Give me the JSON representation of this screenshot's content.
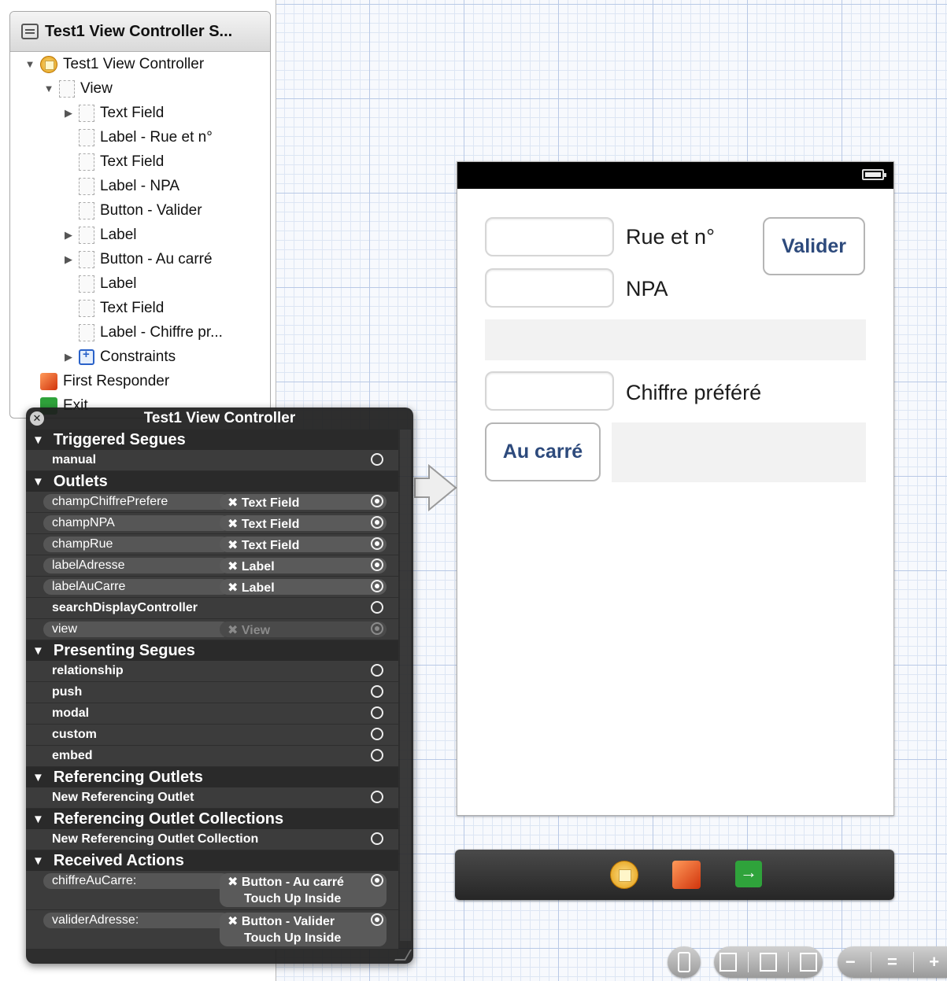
{
  "outline": {
    "header": "Test1 View Controller S...",
    "items": [
      {
        "label": "Test1 View Controller"
      },
      {
        "label": "View"
      },
      {
        "label": "Text Field"
      },
      {
        "label": "Label - Rue et n°"
      },
      {
        "label": "Text Field"
      },
      {
        "label": "Label - NPA"
      },
      {
        "label": "Button - Valider"
      },
      {
        "label": "Label"
      },
      {
        "label": "Button - Au carré"
      },
      {
        "label": "Label"
      },
      {
        "label": "Text Field"
      },
      {
        "label": "Label - Chiffre pr..."
      },
      {
        "label": "Constraints"
      },
      {
        "label": "First Responder"
      },
      {
        "label": "Exit"
      }
    ]
  },
  "hud": {
    "title": "Test1 View Controller",
    "sections": {
      "triggered_segues": "Triggered Segues",
      "outlets": "Outlets",
      "presenting_segues": "Presenting Segues",
      "referencing_outlets": "Referencing Outlets",
      "referencing_outlet_collections": "Referencing Outlet Collections",
      "received_actions": "Received Actions"
    },
    "triggered": [
      "manual"
    ],
    "outlets": [
      {
        "name": "champChiffrePrefere",
        "target": "Text Field"
      },
      {
        "name": "champNPA",
        "target": "Text Field"
      },
      {
        "name": "champRue",
        "target": "Text Field"
      },
      {
        "name": "labelAdresse",
        "target": "Label"
      },
      {
        "name": "labelAuCarre",
        "target": "Label"
      },
      {
        "name": "searchDisplayController",
        "target": ""
      },
      {
        "name": "view",
        "target": "View"
      }
    ],
    "presenting": [
      "relationship",
      "push",
      "modal",
      "custom",
      "embed"
    ],
    "referencing": [
      "New Referencing Outlet"
    ],
    "referencing_collections": [
      "New Referencing Outlet Collection"
    ],
    "actions": [
      {
        "name": "chiffreAuCarre:",
        "target": "Button - Au carré",
        "event": "Touch Up Inside"
      },
      {
        "name": "validerAdresse:",
        "target": "Button - Valider",
        "event": "Touch Up Inside"
      }
    ]
  },
  "scene": {
    "label_rue": "Rue et n°",
    "label_npa": "NPA",
    "label_chiffre": "Chiffre préféré",
    "button_valider": "Valider",
    "button_au_carre": "Au carré"
  },
  "icons": {
    "close": "close-icon",
    "disclosure": "disclosure-triangle-icon",
    "remove_connection": "remove-connection-icon"
  }
}
